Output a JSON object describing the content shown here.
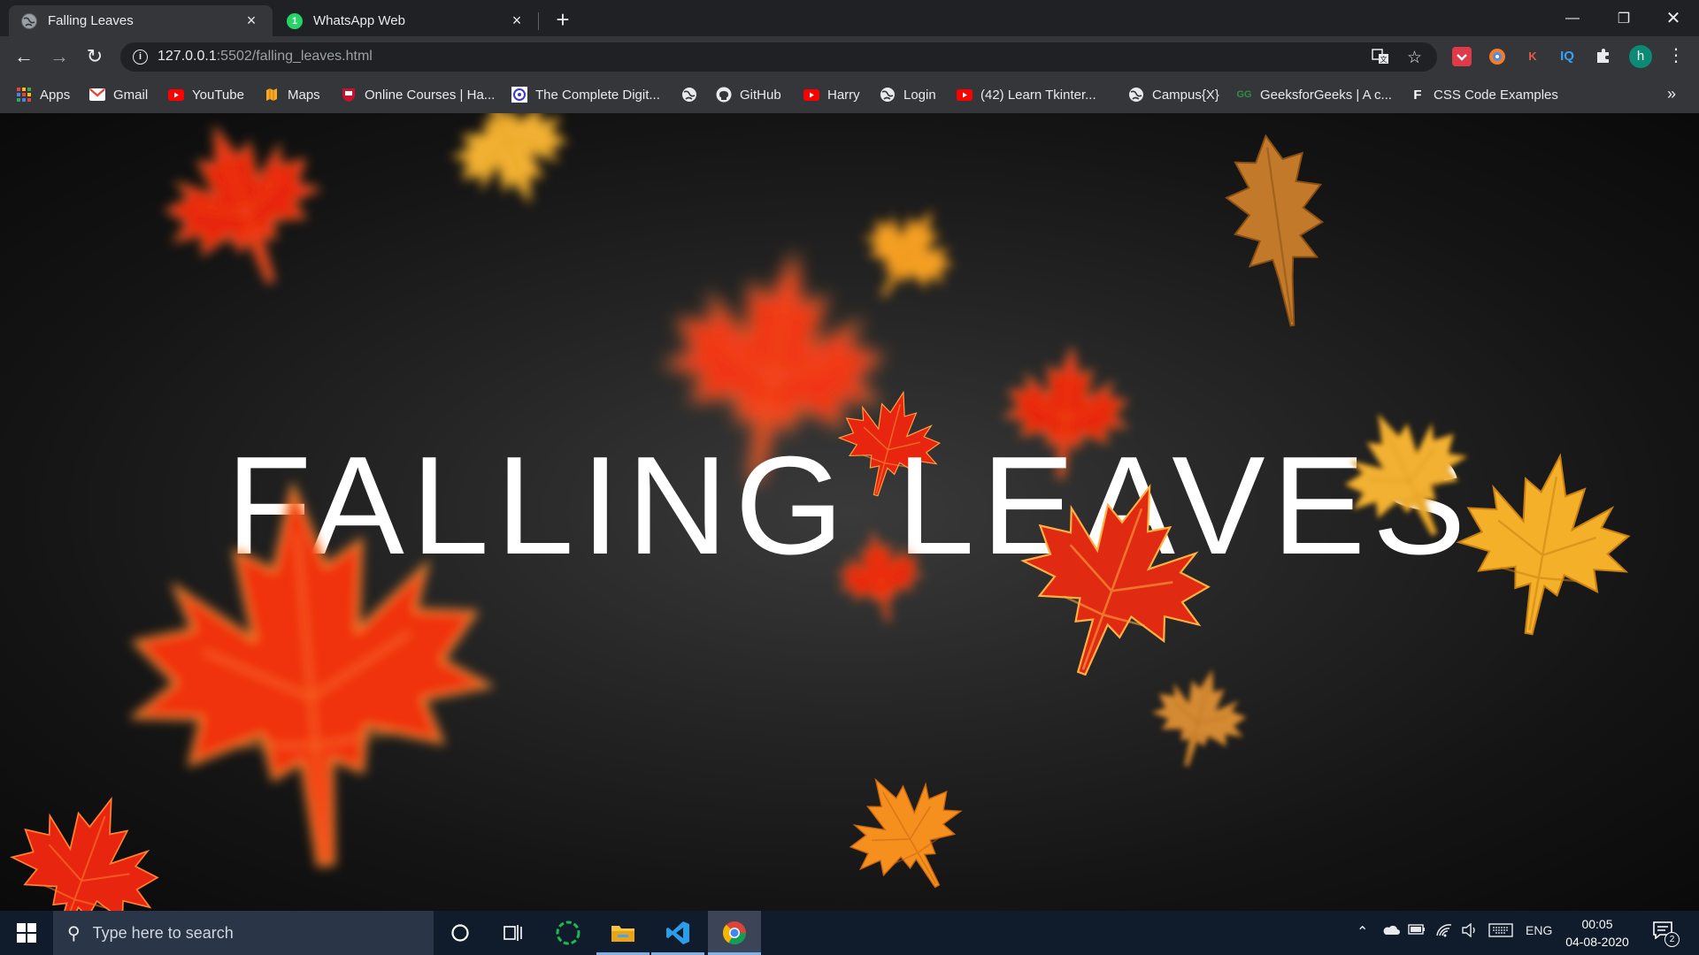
{
  "browser": {
    "tabs": [
      {
        "title": "Falling Leaves",
        "favicon": "globe-icon",
        "active": true
      },
      {
        "title": "WhatsApp Web",
        "favicon": "whatsapp-icon",
        "favicon_text": "1",
        "active": false
      }
    ],
    "url": {
      "host": "127.0.0.1",
      "rest": ":5502/falling_leaves.html"
    },
    "bookmarks": [
      {
        "label": "Apps",
        "icon": "apps-grid-icon"
      },
      {
        "label": "Gmail",
        "icon": "gmail-icon"
      },
      {
        "label": "YouTube",
        "icon": "youtube-icon"
      },
      {
        "label": "Maps",
        "icon": "maps-icon"
      },
      {
        "label": "Online Courses | Ha...",
        "icon": "harvard-icon"
      },
      {
        "label": "The Complete Digit...",
        "icon": "course-icon"
      },
      {
        "label": "",
        "icon": "globe-icon"
      },
      {
        "label": "GitHub",
        "icon": "github-icon"
      },
      {
        "label": "Harry",
        "icon": "youtube-icon"
      },
      {
        "label": "Login",
        "icon": "globe-icon"
      },
      {
        "label": "(42) Learn Tkinter...",
        "icon": "youtube-icon"
      },
      {
        "label": "Campus{X}",
        "icon": "globe-icon"
      },
      {
        "label": "GeeksforGeeks | A c...",
        "icon": "gfg-icon",
        "icon_text": "GG"
      },
      {
        "label": "CSS Code Examples",
        "icon": "css-examples-icon",
        "icon_text": "F"
      }
    ],
    "more_bookmarks": "»",
    "extensions": [
      {
        "name": "pocket-extension-icon",
        "text": ""
      },
      {
        "name": "colorful-extension-icon",
        "text": ""
      },
      {
        "name": "k-extension-icon",
        "text": "K"
      },
      {
        "name": "iq-extension-icon",
        "text": "IQ"
      }
    ],
    "profile_initial": "h"
  },
  "page": {
    "heading": "FALLING LEAVES"
  },
  "taskbar": {
    "search_placeholder": "Type here to search",
    "language": "ENG",
    "time": "00:05",
    "date": "04-08-2020",
    "notification_count": "2"
  },
  "colors": {
    "leaf_red": "#e8260f",
    "leaf_orange": "#f5901e",
    "leaf_gold": "#f2b130",
    "leaf_brown": "#c27a2a",
    "chrome_dark": "#202124",
    "chrome_toolbar": "#35363a",
    "taskbar": "#101b2b"
  }
}
